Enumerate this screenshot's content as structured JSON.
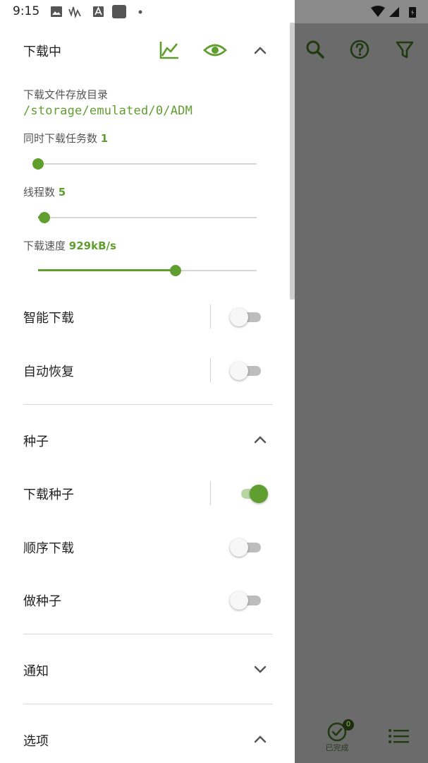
{
  "status_bar": {
    "time": "9:15"
  },
  "downloading": {
    "header": "下载中",
    "dir_label": "下载文件存放目录",
    "dir_path": "/storage/emulated/0/ADM",
    "concurrent_label": "同时下载任务数",
    "concurrent_value": "1",
    "concurrent_fraction": 0.0,
    "threads_label": "线程数",
    "threads_value": "5",
    "threads_fraction": 0.03,
    "speed_label": "下载速度",
    "speed_value": "929kB/s",
    "speed_fraction": 0.63,
    "smart_download_label": "智能下载",
    "smart_download_on": false,
    "auto_resume_label": "自动恢复",
    "auto_resume_on": false
  },
  "torrent": {
    "header": "种子",
    "download_torrent_label": "下载种子",
    "download_torrent_on": true,
    "sequential_label": "顺序下载",
    "sequential_on": false,
    "seeding_label": "做种子",
    "seeding_on": false
  },
  "notification": {
    "header": "通知"
  },
  "options": {
    "header": "选项"
  },
  "main": {
    "done_label": "已完成",
    "done_count": "0"
  },
  "colors": {
    "accent": "#5f9e2f",
    "scrim": "#6b6b6b"
  }
}
